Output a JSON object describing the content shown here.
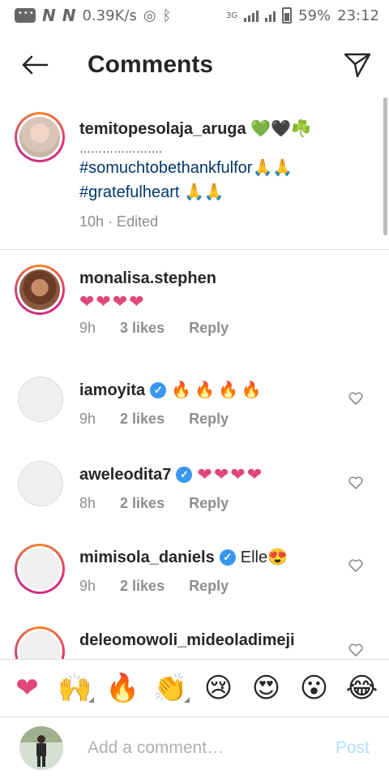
{
  "status_bar": {
    "speed": "0.39K/s",
    "network": "3G",
    "battery": "59%",
    "time": "23:12"
  },
  "header": {
    "title": "Comments",
    "back_icon": "arrow-left-icon",
    "send_icon": "paper-plane-icon"
  },
  "caption": {
    "username": "temitopesolaja_aruga",
    "emojis": "💚🖤☘️",
    "dots": "………………….",
    "hashtag1": "#somuchtobethankfulfor",
    "hashtag1_emoji": "🙏🙏",
    "hashtag2": "#gratefulheart",
    "hashtag2_emoji": " 🙏🙏",
    "time": "10h",
    "edited": "· Edited"
  },
  "comments": [
    {
      "username": "monalisa.stephen",
      "verified": false,
      "text": "❤❤❤❤",
      "time": "9h",
      "likes": "3 likes",
      "reply": "Reply"
    },
    {
      "username": "iamoyita",
      "verified": true,
      "text": "🔥🔥🔥🔥",
      "time": "9h",
      "likes": "2 likes",
      "reply": "Reply"
    },
    {
      "username": "aweleodita7",
      "verified": true,
      "text": "❤❤❤❤",
      "time": "8h",
      "likes": "2 likes",
      "reply": "Reply"
    },
    {
      "username": "mimisola_daniels",
      "verified": true,
      "text": "Elle😍",
      "time": "9h",
      "likes": "2 likes",
      "reply": "Reply"
    },
    {
      "username": "deleomowoli_mideoladimeji",
      "verified": true,
      "text": "",
      "time": "",
      "likes": "",
      "reply": ""
    }
  ],
  "emoji_bar": [
    "❤",
    "🙌",
    "🔥",
    "👏",
    "😢",
    "😍",
    "😮",
    "😂"
  ],
  "add_comment": {
    "placeholder": "Add a comment…",
    "post_label": "Post"
  },
  "colors": {
    "hashtag": "#00376b",
    "verified": "#3897f0",
    "post_disabled": "#b2dffc",
    "meta": "#8e8e8e"
  }
}
